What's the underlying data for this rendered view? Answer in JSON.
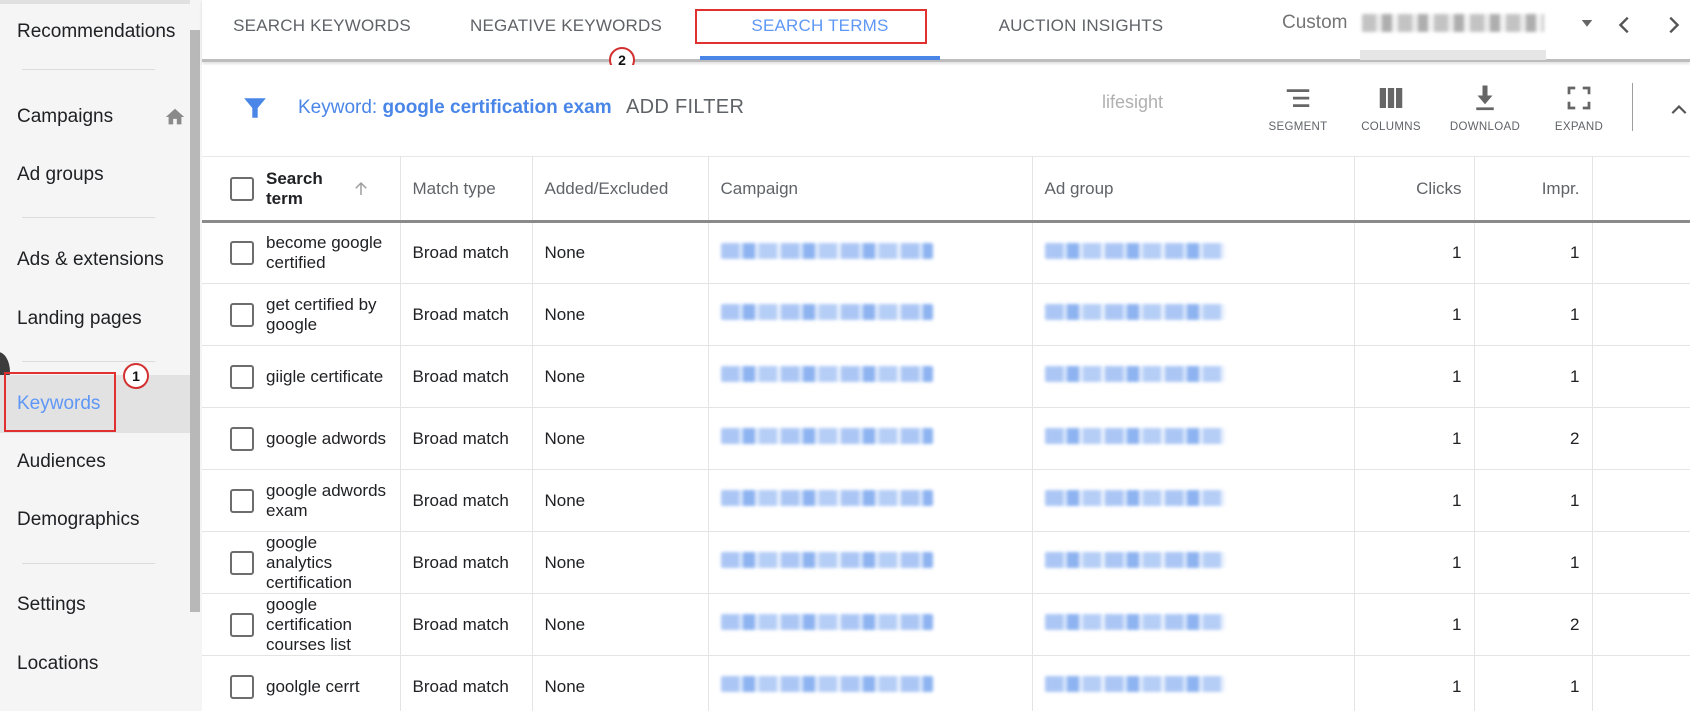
{
  "sidebar": {
    "items": [
      {
        "label": "Recommendations",
        "active": false
      },
      {
        "label": "Campaigns",
        "active": false,
        "icon": "home-icon"
      },
      {
        "label": "Ad groups",
        "active": false
      },
      {
        "label": "Ads & extensions",
        "active": false
      },
      {
        "label": "Landing pages",
        "active": false
      },
      {
        "label": "Keywords",
        "active": true
      },
      {
        "label": "Audiences",
        "active": false
      },
      {
        "label": "Demographics",
        "active": false
      },
      {
        "label": "Settings",
        "active": false
      },
      {
        "label": "Locations",
        "active": false
      }
    ]
  },
  "tabs": [
    {
      "label": "SEARCH KEYWORDS",
      "active": false
    },
    {
      "label": "NEGATIVE KEYWORDS",
      "active": false
    },
    {
      "label": "SEARCH TERMS",
      "active": true
    },
    {
      "label": "AUCTION INSIGHTS",
      "active": false
    }
  ],
  "date_selector": {
    "preset": "Custom",
    "range": "[redacted]"
  },
  "filter": {
    "label": "Keyword:",
    "value": "google certification exam",
    "add_filter_label": "ADD FILTER"
  },
  "watermark": "lifesight",
  "toolbar": {
    "segment_label": "SEGMENT",
    "columns_label": "COLUMNS",
    "download_label": "DOWNLOAD",
    "expand_label": "EXPAND"
  },
  "table": {
    "columns": [
      "Search term",
      "Match type",
      "Added/Excluded",
      "Campaign",
      "Ad group",
      "Clicks",
      "Impr."
    ],
    "sort": {
      "column": "Search term",
      "direction": "ascending"
    },
    "rows": [
      {
        "search_term": "become google certified",
        "match_type": "Broad match",
        "added_excluded": "None",
        "campaign": "[redacted]",
        "ad_group": "[redacted]",
        "clicks": "1",
        "impr": "1"
      },
      {
        "search_term": "get certified by google",
        "match_type": "Broad match",
        "added_excluded": "None",
        "campaign": "[redacted]",
        "ad_group": "[redacted]",
        "clicks": "1",
        "impr": "1"
      },
      {
        "search_term": "giigle certificate",
        "match_type": "Broad match",
        "added_excluded": "None",
        "campaign": "[redacted]",
        "ad_group": "[redacted]",
        "clicks": "1",
        "impr": "1"
      },
      {
        "search_term": "google adwords",
        "match_type": "Broad match",
        "added_excluded": "None",
        "campaign": "[redacted]",
        "ad_group": "[redacted]",
        "clicks": "1",
        "impr": "2"
      },
      {
        "search_term": "google adwords exam",
        "match_type": "Broad match",
        "added_excluded": "None",
        "campaign": "[redacted]",
        "ad_group": "[redacted]",
        "clicks": "1",
        "impr": "1"
      },
      {
        "search_term": "google analytics certification",
        "match_type": "Broad match",
        "added_excluded": "None",
        "campaign": "[redacted]",
        "ad_group": "[redacted]",
        "clicks": "1",
        "impr": "1"
      },
      {
        "search_term": "google certification courses list",
        "match_type": "Broad match",
        "added_excluded": "None",
        "campaign": "[redacted]",
        "ad_group": "[redacted]",
        "clicks": "1",
        "impr": "2"
      },
      {
        "search_term": "goolgle cerrt",
        "match_type": "Broad match",
        "added_excluded": "None",
        "campaign": "[redacted]",
        "ad_group": "[redacted]",
        "clicks": "1",
        "impr": "1"
      }
    ]
  },
  "annotations": [
    {
      "number": "1",
      "target": "Keywords"
    },
    {
      "number": "2",
      "target": "SEARCH TERMS"
    }
  ],
  "colors": {
    "accent": "#4a86e8",
    "active_text": "#5e97f6",
    "annotation": "#e03030"
  }
}
